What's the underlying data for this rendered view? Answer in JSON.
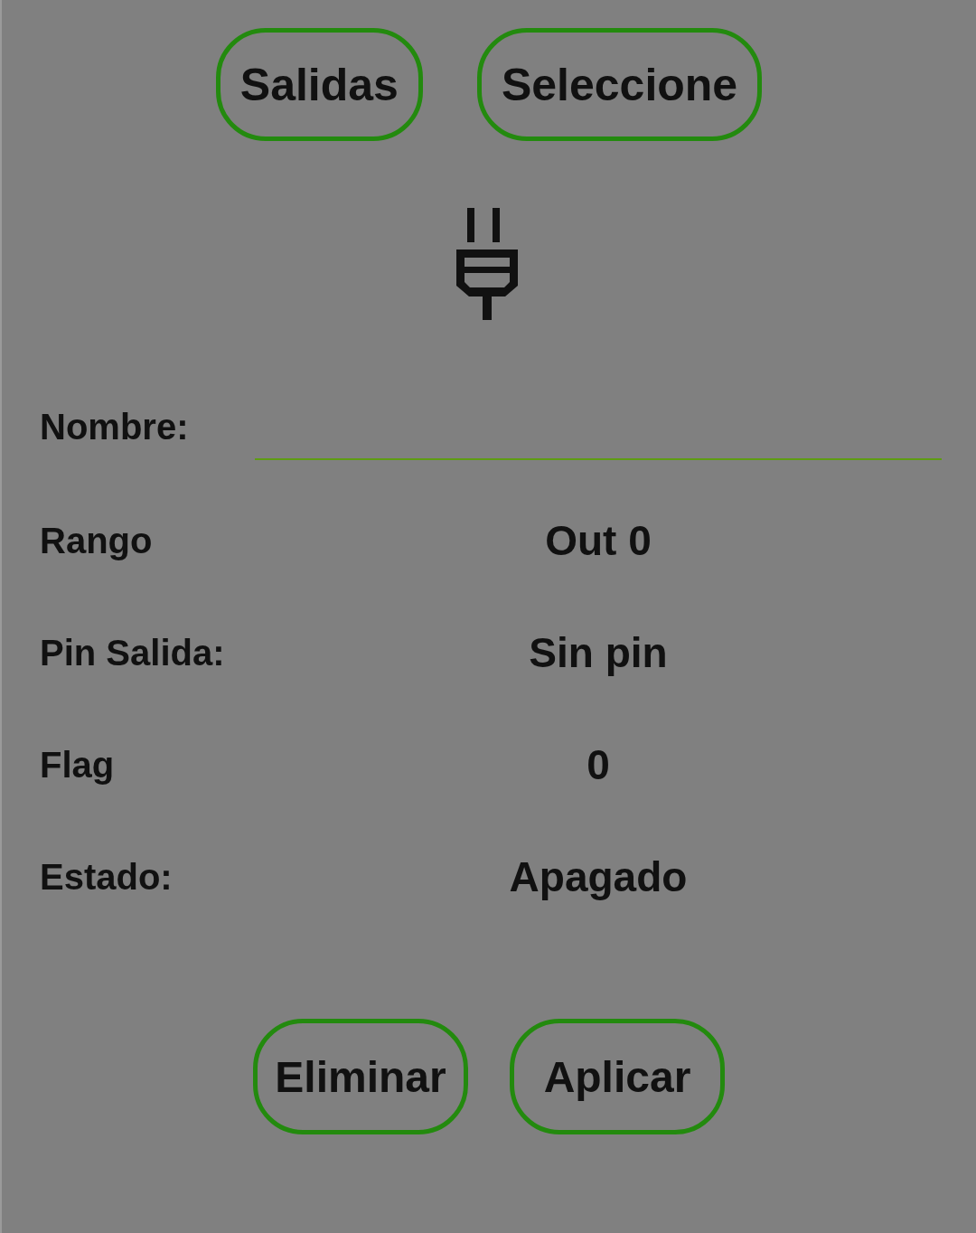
{
  "top_buttons": [
    {
      "label": "Salidas"
    },
    {
      "label": "Seleccione"
    }
  ],
  "name_field": {
    "label": "Nombre:"
  },
  "rows": [
    {
      "label": "Rango",
      "value": "Out 0"
    },
    {
      "label": "Pin Salida:",
      "value": "Sin pin"
    },
    {
      "label": "Flag",
      "value": "0"
    },
    {
      "label": "Estado:",
      "value": "Apagado"
    }
  ],
  "bottom_buttons": [
    {
      "label": "Eliminar"
    },
    {
      "label": "Aplicar"
    }
  ]
}
